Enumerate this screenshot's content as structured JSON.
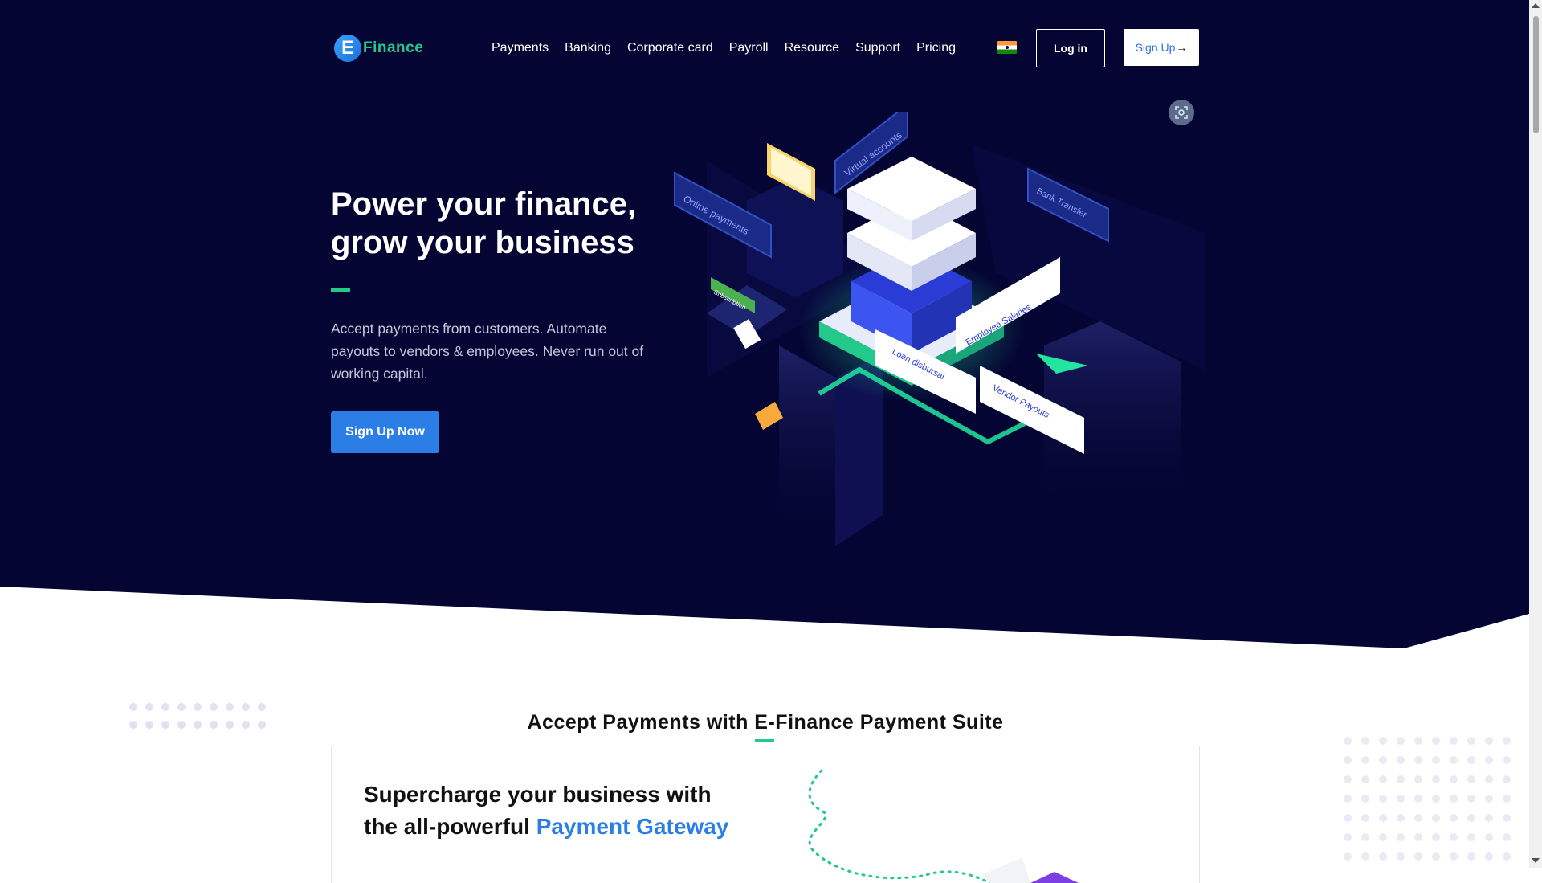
{
  "brand": {
    "logo_letter": "E",
    "name": "Finance"
  },
  "nav": {
    "links": [
      "Payments",
      "Banking",
      "Corporate card",
      "Payroll",
      "Resource",
      "Support",
      "Pricing"
    ],
    "login_label": "Log in",
    "signup_label": "Sign Up",
    "signup_arrow": "→",
    "region_flag": "india-flag-icon"
  },
  "hero": {
    "title_line1": "Power your finance,",
    "title_line2": "grow your business",
    "subtitle": "Accept payments from customers. Automate payouts to vendors & employees. Never run out of working capital.",
    "cta_label": "Sign Up Now",
    "illustration_labels": {
      "virtual_accounts": "Virtual accounts",
      "online_payments": "Online payments",
      "bank_transfer": "Bank Transfer",
      "subscription": "Subscription",
      "employee_salaries": "Employee Salaries",
      "loan_disbursal": "Loan disbursal",
      "vendor_payouts": "Vendor Payouts"
    }
  },
  "suite": {
    "title": "Accept Payments with E-Finance Payment Suite",
    "card_title_line1": "Supercharge your business with",
    "card_title_line2_prefix": "the all-powerful ",
    "card_title_highlight": "Payment Gateway"
  },
  "colors": {
    "hero_bg": "#050533",
    "accent_green": "#22c98a",
    "primary_blue": "#2b7ee6",
    "text_muted": "#c4c6dc"
  }
}
